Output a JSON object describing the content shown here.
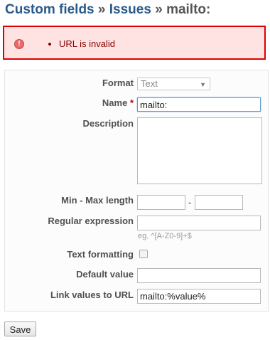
{
  "breadcrumb": {
    "root": "Custom fields",
    "separator": "»",
    "middle": "Issues",
    "current": "mailto:"
  },
  "flash": {
    "icon": "error-icon",
    "icon_glyph": "!",
    "message": "URL is invalid"
  },
  "form": {
    "format": {
      "label": "Format",
      "value": "Text"
    },
    "name": {
      "label": "Name",
      "required_mark": "*",
      "value": "mailto:"
    },
    "description": {
      "label": "Description",
      "value": ""
    },
    "min_max": {
      "label": "Min - Max length",
      "dash": "-",
      "min": "",
      "max": ""
    },
    "regex": {
      "label": "Regular expression",
      "value": "",
      "hint": "eg. ^[A-Z0-9]+$"
    },
    "text_formatting": {
      "label": "Text formatting",
      "checked": false
    },
    "default_value": {
      "label": "Default value",
      "value": ""
    },
    "link_url": {
      "label": "Link values to URL",
      "value": "mailto:%value%"
    }
  },
  "actions": {
    "save_label": "Save"
  },
  "colors": {
    "link": "#2a5a8a",
    "error_border": "#dd0000",
    "error_bg": "#ffe3e3",
    "error_text": "#880000",
    "required": "#bb0000",
    "focus_border": "#5e9bd1"
  }
}
